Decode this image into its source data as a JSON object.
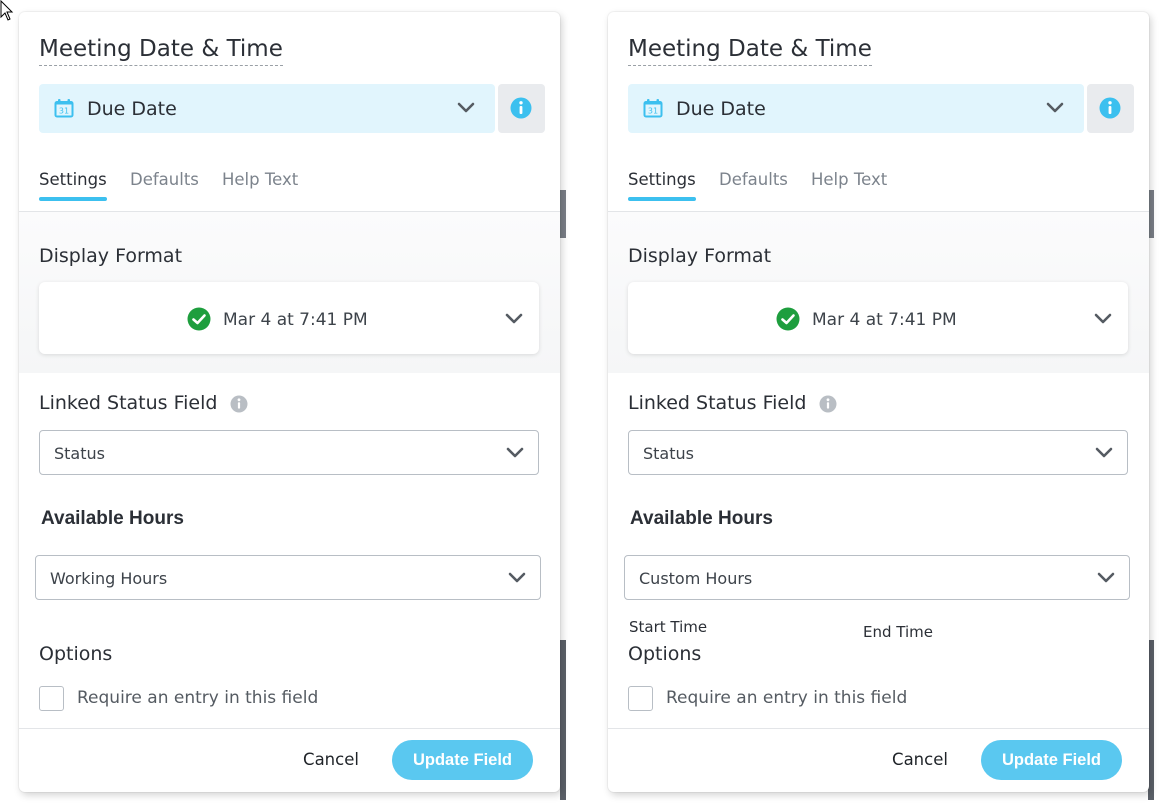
{
  "colors": {
    "accent": "#3cc0ef",
    "type_select_bg": "#e1f5fd",
    "check_green": "#1e9e3e",
    "update_button": "#5ac8f0"
  },
  "panels": [
    {
      "title": "Meeting Date & Time",
      "field_type": {
        "icon": "calendar-icon",
        "icon_text": "31",
        "label": "Due Date"
      },
      "tabs": [
        {
          "label": "Settings",
          "active": true
        },
        {
          "label": "Defaults",
          "active": false
        },
        {
          "label": "Help Text",
          "active": false
        }
      ],
      "display_format": {
        "label": "Display Format",
        "value": "Mar 4 at 7:41 PM"
      },
      "linked_status": {
        "label": "Linked Status Field",
        "value": "Status"
      },
      "available_hours": {
        "label": "Available Hours",
        "value": "Working Hours"
      },
      "options": {
        "label": "Options",
        "require_entry": "Require an entry in this field"
      },
      "footer": {
        "cancel": "Cancel",
        "update": "Update Field"
      }
    },
    {
      "title": "Meeting Date & Time",
      "field_type": {
        "icon": "calendar-icon",
        "icon_text": "31",
        "label": "Due Date"
      },
      "tabs": [
        {
          "label": "Settings",
          "active": true
        },
        {
          "label": "Defaults",
          "active": false
        },
        {
          "label": "Help Text",
          "active": false
        }
      ],
      "display_format": {
        "label": "Display Format",
        "value": "Mar 4 at 7:41 PM"
      },
      "linked_status": {
        "label": "Linked Status Field",
        "value": "Status"
      },
      "available_hours": {
        "label": "Available Hours",
        "value": "Custom Hours"
      },
      "custom_hours": {
        "start_label": "Start Time",
        "end_label": "End Time"
      },
      "options": {
        "label": "Options",
        "require_entry": "Require an entry in this field"
      },
      "footer": {
        "cancel": "Cancel",
        "update": "Update Field"
      }
    }
  ]
}
